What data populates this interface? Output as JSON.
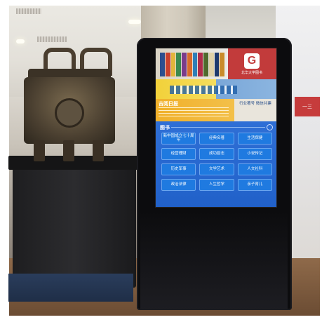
{
  "scene": {
    "sign_text": "一三"
  },
  "screen": {
    "logo_letter": "G",
    "logo_caption": "北华大学图书",
    "notice_title": "吉阅日报",
    "side_text": "行业著号 微信共建",
    "menu_title": "图书",
    "categories": [
      "新中国成立七十周年",
      "经典名著",
      "生活保健",
      "经营理财",
      "成功励志",
      "小说传记",
      "历史军事",
      "文学艺术",
      "人文社科",
      "政治法律",
      "人生哲学",
      "亲子育儿"
    ],
    "colors": {
      "menu_blue": "#2161c9",
      "tile_blue": "#1f7ae0",
      "logo_red": "#c23b3b",
      "notice_orange": "#f0b02a",
      "band_yellow": "#f2d13a"
    }
  }
}
